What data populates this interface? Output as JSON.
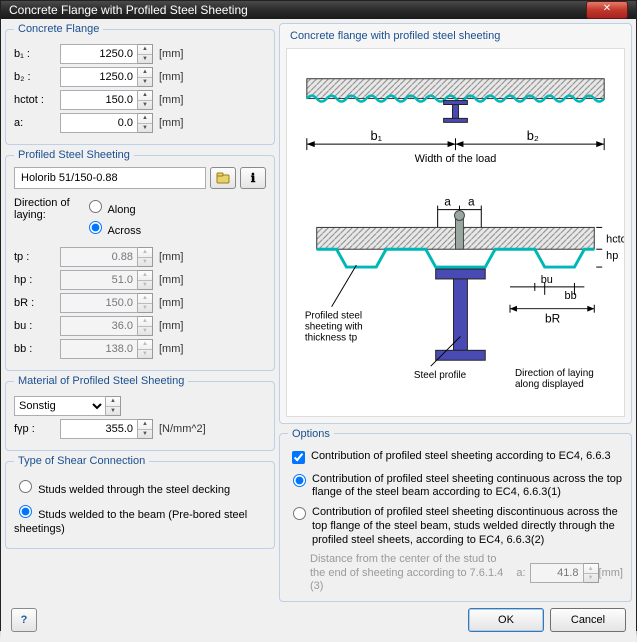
{
  "window": {
    "title": "Concrete Flange with Profiled Steel Sheeting"
  },
  "flange": {
    "legend": "Concrete Flange",
    "b1": {
      "label": "b₁ :",
      "value": "1250.0",
      "unit": "[mm]"
    },
    "b2": {
      "label": "b₂ :",
      "value": "1250.0",
      "unit": "[mm]"
    },
    "hctot": {
      "label": "hctot :",
      "value": "150.0",
      "unit": "[mm]"
    },
    "a": {
      "label": "a:",
      "value": "0.0",
      "unit": "[mm]"
    }
  },
  "sheeting": {
    "legend": "Profiled Steel Sheeting",
    "name": "Holorib 51/150-0.88",
    "direction_label": "Direction of laying:",
    "opt_along": "Along",
    "opt_across": "Across",
    "direction": "across",
    "tp": {
      "label": "tp :",
      "value": "0.88",
      "unit": "[mm]"
    },
    "hp": {
      "label": "hp :",
      "value": "51.0",
      "unit": "[mm]"
    },
    "bR": {
      "label": "bR :",
      "value": "150.0",
      "unit": "[mm]"
    },
    "bu": {
      "label": "bu :",
      "value": "36.0",
      "unit": "[mm]"
    },
    "bb": {
      "label": "bb :",
      "value": "138.0",
      "unit": "[mm]"
    }
  },
  "material": {
    "legend": "Material of Profiled Steel Sheeting",
    "selected": "Sonstig",
    "fyp": {
      "label": "fγp :",
      "value": "355.0",
      "unit": "[N/mm^2]"
    }
  },
  "shear": {
    "legend": "Type of Shear Connection",
    "opt1": "Studs welded through the steel decking",
    "opt2": "Studs welded to the beam (Pre-bored steel sheetings)",
    "selected": "opt2"
  },
  "options": {
    "legend": "Options",
    "contrib_check": "Contribution of profiled steel sheeting according to EC4, 6.6.3",
    "contrib_on": true,
    "radio1": "Contribution of profiled steel sheeting continuous across the top flange of the steel beam according to EC4, 6.6.3(1)",
    "radio2": "Contribution of profiled steel sheeting discontinuous across the top flange of the steel beam, studs welded directly through the profiled steel sheets, according to EC4, 6.6.3(2)",
    "radio_selected": "radio1",
    "dist_label": "Distance from the center of the stud to the end of sheeting according to 7.6.1.4 (3)",
    "dist_a": "a:",
    "dist_value": "41.8",
    "dist_unit": "[mm]"
  },
  "diagram": {
    "title": "Concrete flange with profiled steel sheeting",
    "width_label": "Width of the load",
    "b1": "b₁",
    "b2": "b₂",
    "a": "a",
    "hp": "hp",
    "hctot": "hctot",
    "bu": "bu",
    "bb": "bb",
    "bR": "bR",
    "text1": "Profiled steel sheeting with thickness tp",
    "text2": "Steel profile",
    "text3": "Direction of laying along displayed"
  },
  "footer": {
    "ok": "OK",
    "cancel": "Cancel"
  }
}
